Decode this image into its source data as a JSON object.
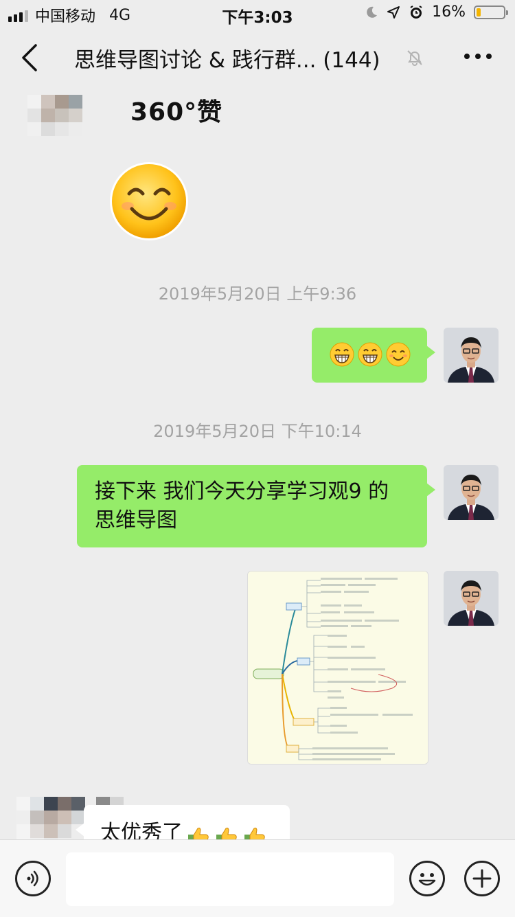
{
  "status_bar": {
    "carrier": "中国移动",
    "network": "4G",
    "time": "下午3:03",
    "battery_percent": "16%",
    "battery_level": 0.16,
    "battery_color": "#f4b400"
  },
  "nav": {
    "title": "思维导图讨论 & 践行群... (144)",
    "back_icon": "chevron-left-icon",
    "mute_icon": "bell-muted-icon",
    "more_icon": "more-dots-icon"
  },
  "messages": {
    "first_partial_text": "360°赞",
    "big_emoji": "smiling-face-emoji",
    "timestamp_1": "2019年5月20日 上午9:36",
    "timestamp_2": "2019年5月20日 下午10:14",
    "emoji_message": [
      "grinning-face-emoji",
      "grinning-face-emoji",
      "smiling-face-emoji"
    ],
    "text_message": "接下来 我们今天分享学习观9 的思维导图",
    "image_message": "mind-map-image",
    "last_partial_text": "太优秀了",
    "last_partial_emoji": [
      "thumbs-up-emoji",
      "thumbs-up-emoji",
      "thumbs-up-emoji"
    ]
  },
  "input_bar": {
    "voice_icon": "voice-icon",
    "emoji_icon": "emoji-face-icon",
    "add_icon": "plus-icon",
    "input_value": ""
  },
  "colors": {
    "background": "#ededed",
    "sent_bubble": "#95ec69",
    "received_bubble": "#ffffff",
    "timestamp_text": "#a3a3a3"
  }
}
